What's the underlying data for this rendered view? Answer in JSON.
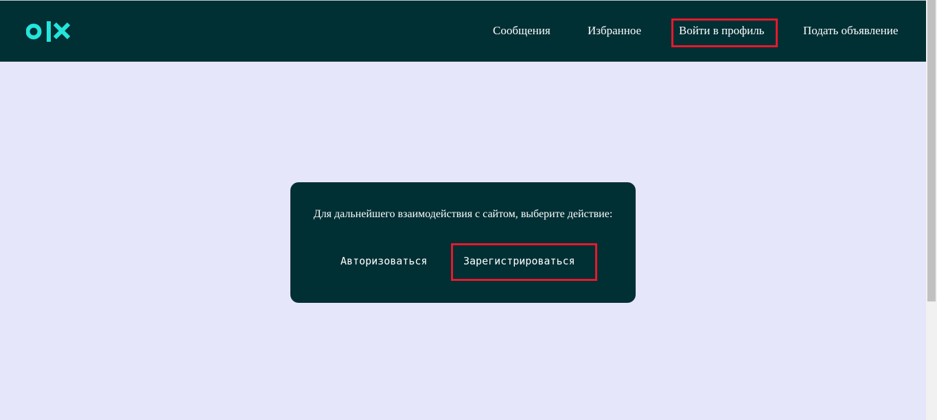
{
  "header": {
    "logo": {
      "icon": "olx-logo",
      "color": "#23e5db"
    },
    "nav": [
      {
        "label": "Сообщения"
      },
      {
        "label": "Избранное"
      },
      {
        "label": "Войти в профиль"
      },
      {
        "label": "Подать объявление"
      }
    ]
  },
  "dialog": {
    "message": "Для дальнейшего взаимодействия с сайтом, выберите действие:",
    "buttons": [
      {
        "label": "Авторизоваться"
      },
      {
        "label": "Зарегистрироваться"
      }
    ]
  },
  "colors": {
    "header_bg": "#002f34",
    "page_bg": "#e6e6fa",
    "highlight": "#e8192c",
    "text": "#ffffff"
  }
}
